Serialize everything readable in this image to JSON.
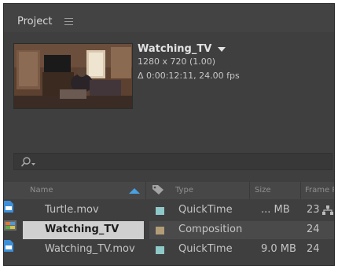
{
  "panel": {
    "title": "Project",
    "menu_icon": "hamburger-menu-icon"
  },
  "preview": {
    "name": "Watching_TV",
    "resolution": "1280 x 720 (1.00)",
    "duration": "Δ 0:00:12:11, 24.00 fps",
    "thumbnail": "living-room-video-frame"
  },
  "search": {
    "icon": "search-icon",
    "value": ""
  },
  "columns": {
    "name": "Name",
    "type": "Type",
    "size": "Size",
    "frame": "Frame R",
    "sort_icon": "sort-ascending-icon",
    "label_icon": "label-tag-icon"
  },
  "colors": {
    "panel_bg": "#3f3f3f",
    "selection": "#d0d0d0",
    "aqua_label": "#8fc8c8",
    "sand_label": "#b39c78",
    "file_icon": "#3d8fd8"
  },
  "rows": [
    {
      "name": "Turtle.mov",
      "type": "QuickTime",
      "size": "... MB",
      "frame": "23",
      "icon": "footage-file-icon",
      "label_color": "#8fc8c8",
      "selected": false
    },
    {
      "name": "Watching_TV",
      "type": "Composition",
      "size": "",
      "frame": "24",
      "icon": "composition-icon",
      "label_color": "#b39c78",
      "selected": true
    },
    {
      "name": "Watching_TV.mov",
      "type": "QuickTime",
      "size": "9.0 MB",
      "frame": "24",
      "icon": "footage-file-icon",
      "label_color": "#8fc8c8",
      "selected": false
    }
  ],
  "flowchart_icon": "flowchart-icon"
}
